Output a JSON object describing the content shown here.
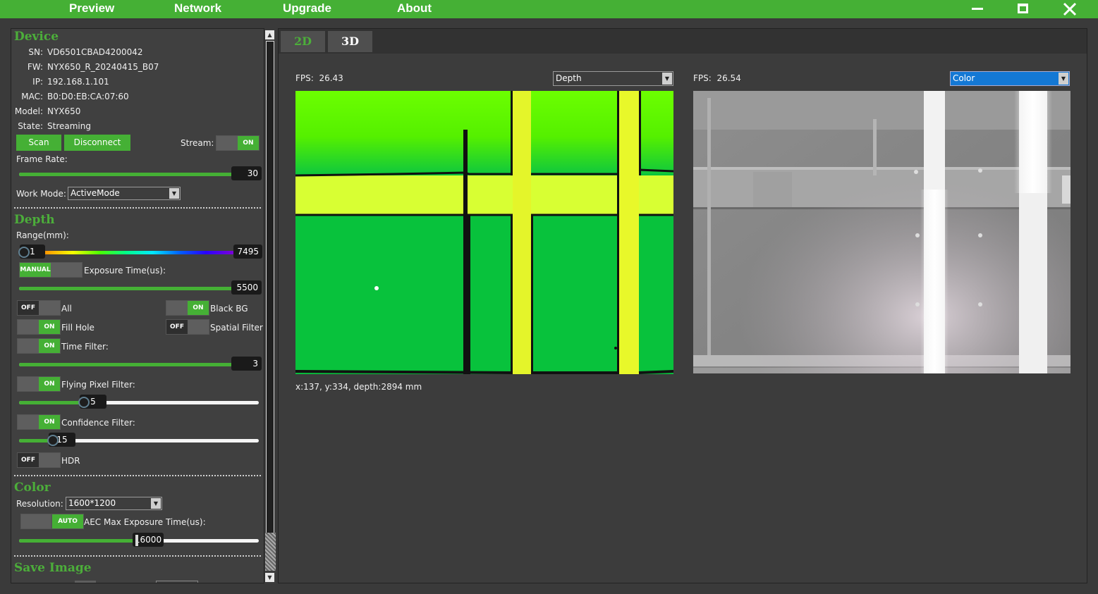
{
  "menu": {
    "items": [
      "Preview",
      "Network",
      "Upgrade",
      "About"
    ]
  },
  "window_controls": {
    "minimize": "—",
    "maximize": "☐",
    "close": "✕"
  },
  "device": {
    "title": "Device",
    "sn_label": "SN:",
    "sn": "VD6501CBAD4200042",
    "fw_label": "FW:",
    "fw": "NYX650_R_20240415_B07",
    "ip_label": "IP:",
    "ip": "192.168.1.101",
    "mac_label": "MAC:",
    "mac": "B0:D0:EB:CA:07:60",
    "model_label": "Model:",
    "model": "NYX650",
    "state_label": "State:",
    "state": "Streaming",
    "scan_button": "Scan",
    "disconnect_button": "Disconnect",
    "stream_label": "Stream:",
    "stream_toggle": "ON",
    "frame_rate_label": "Frame Rate:",
    "frame_rate": "30",
    "frame_rate_level": 1.0,
    "work_mode_label": "Work Mode:",
    "work_mode": "ActiveMode"
  },
  "depth": {
    "title": "Depth",
    "range_label": "Range(mm):",
    "range_min": "1",
    "range_max": "7495",
    "exposure_mode_toggle": "MANUAL",
    "exposure_label": "Exposure Time(us):",
    "exposure": "5500",
    "exposure_level": 1.0,
    "all_toggle": "OFF",
    "all_label": "All",
    "black_bg_toggle": "ON",
    "black_bg_label": "Black BG",
    "fill_hole_toggle": "ON",
    "fill_hole_label": "Fill Hole",
    "spatial_filter_toggle": "OFF",
    "spatial_filter_label": "Spatial Filter",
    "time_filter_toggle": "ON",
    "time_filter_label": "Time Filter:",
    "time_filter": "3",
    "time_filter_level": 1.0,
    "flying_pixel_toggle": "ON",
    "flying_pixel_label": "Flying Pixel Filter:",
    "flying_pixel": "5",
    "flying_pixel_level": 0.27,
    "confidence_toggle": "ON",
    "confidence_label": "Confidence Filter:",
    "confidence": "15",
    "confidence_level": 0.14,
    "hdr_toggle": "OFF",
    "hdr_label": "HDR"
  },
  "color": {
    "title": "Color",
    "resolution_label": "Resolution:",
    "resolution": "1600*1200",
    "aec_toggle": "AUTO",
    "aec_label": "AEC Max Exposure Time(us):",
    "aec_max": "16000",
    "aec_level": 0.49
  },
  "save_image": {
    "title": "Save Image"
  },
  "tabs": [
    "2D",
    "3D"
  ],
  "active_tab": "2D",
  "view_left": {
    "fps_label": "FPS:",
    "fps": "26.43",
    "mode": "Depth"
  },
  "view_right": {
    "fps_label": "FPS:",
    "fps": "26.54",
    "mode": "Color"
  },
  "pixel_info": "x:137, y:334, depth:2894 mm",
  "colors": {
    "accent": "#45b035",
    "title_green": "#4cae3a",
    "panel": "#404040",
    "background": "#3a3a3a",
    "select_active": "#1478d4"
  }
}
